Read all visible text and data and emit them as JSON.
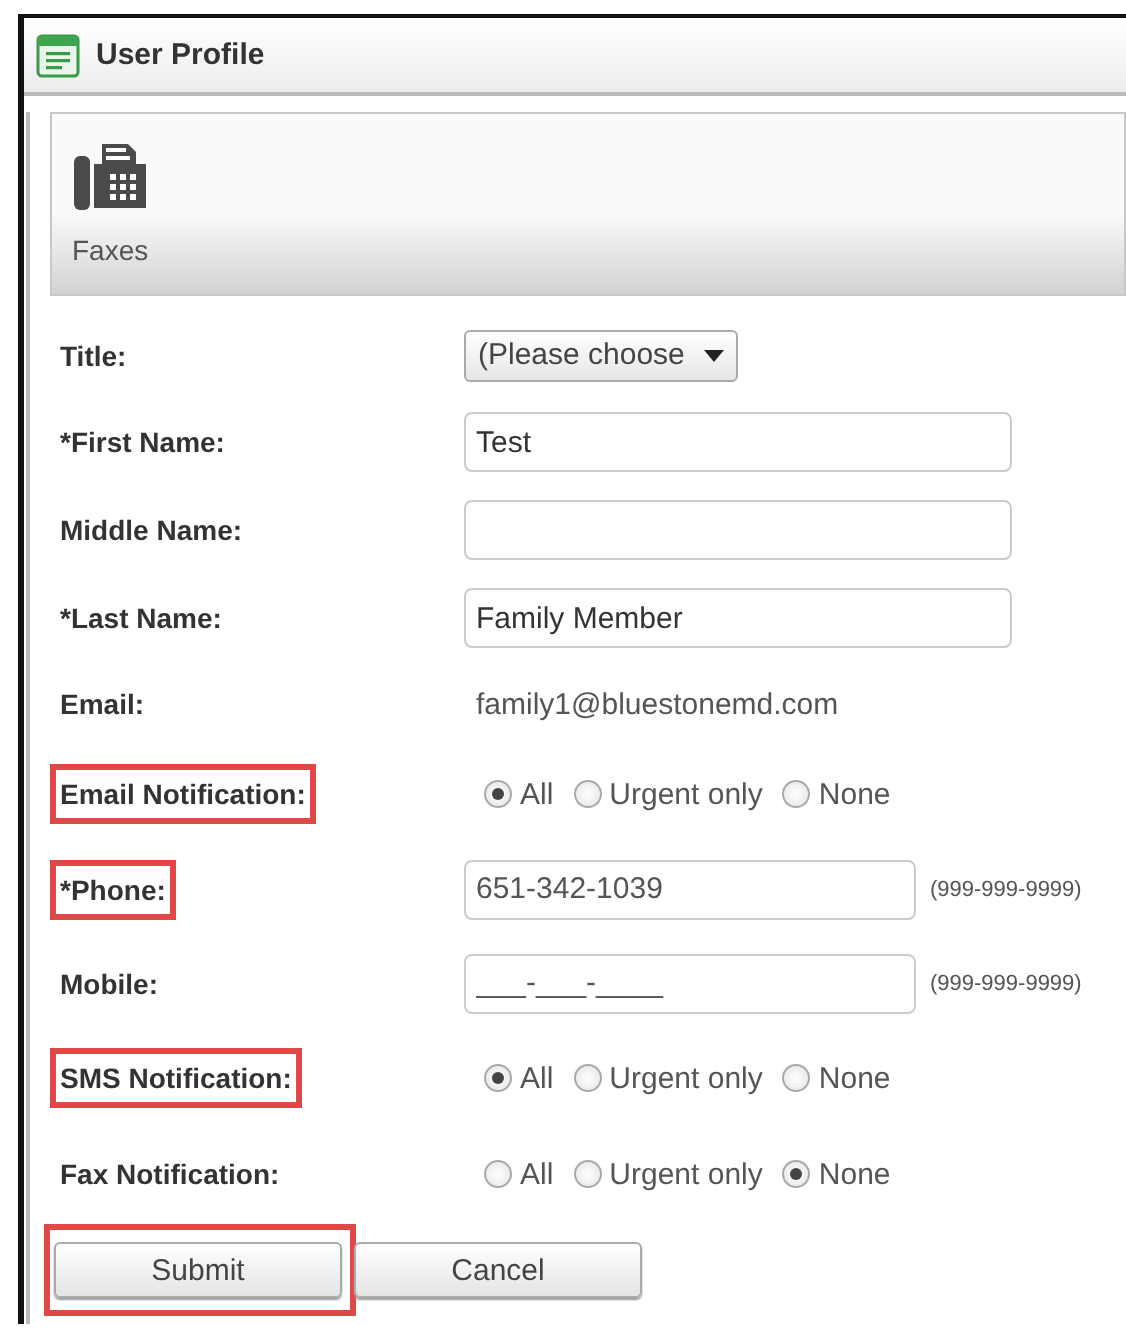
{
  "window": {
    "title": "User Profile"
  },
  "toolbar": {
    "items": [
      {
        "label": "Faxes"
      }
    ]
  },
  "form": {
    "rows": [
      {
        "kind": "select",
        "label": "Title:",
        "highlighted": false,
        "value": "(Please choose"
      },
      {
        "kind": "text",
        "label": "*First Name:",
        "highlighted": false,
        "value": "Test"
      },
      {
        "kind": "text",
        "label": "Middle Name:",
        "highlighted": false,
        "value": ""
      },
      {
        "kind": "text",
        "label": "*Last Name:",
        "highlighted": false,
        "value": "Family Member"
      },
      {
        "kind": "static",
        "label": "Email:",
        "highlighted": false,
        "value": "family1@bluestonemd.com"
      },
      {
        "kind": "radio",
        "label": "Email Notification:",
        "highlighted": true,
        "options": [
          {
            "label": "All",
            "selected": true
          },
          {
            "label": "Urgent only",
            "selected": false
          },
          {
            "label": "None",
            "selected": false
          }
        ]
      },
      {
        "kind": "phone",
        "label": "*Phone:",
        "highlighted": true,
        "value": "651-342-1039",
        "hint": "(999-999-9999)"
      },
      {
        "kind": "phone",
        "label": "Mobile:",
        "highlighted": false,
        "value": "___-___-____",
        "hint": "(999-999-9999)"
      },
      {
        "kind": "radio",
        "label": "SMS Notification:",
        "highlighted": true,
        "options": [
          {
            "label": "All",
            "selected": true
          },
          {
            "label": "Urgent only",
            "selected": false
          },
          {
            "label": "None",
            "selected": false
          }
        ]
      },
      {
        "kind": "radio",
        "label": "Fax Notification:",
        "highlighted": false,
        "options": [
          {
            "label": "All",
            "selected": false
          },
          {
            "label": "Urgent only",
            "selected": false
          },
          {
            "label": "None",
            "selected": true
          }
        ]
      }
    ]
  },
  "buttons": [
    {
      "label": "Submit",
      "highlighted": true
    },
    {
      "label": "Cancel",
      "highlighted": false
    }
  ]
}
